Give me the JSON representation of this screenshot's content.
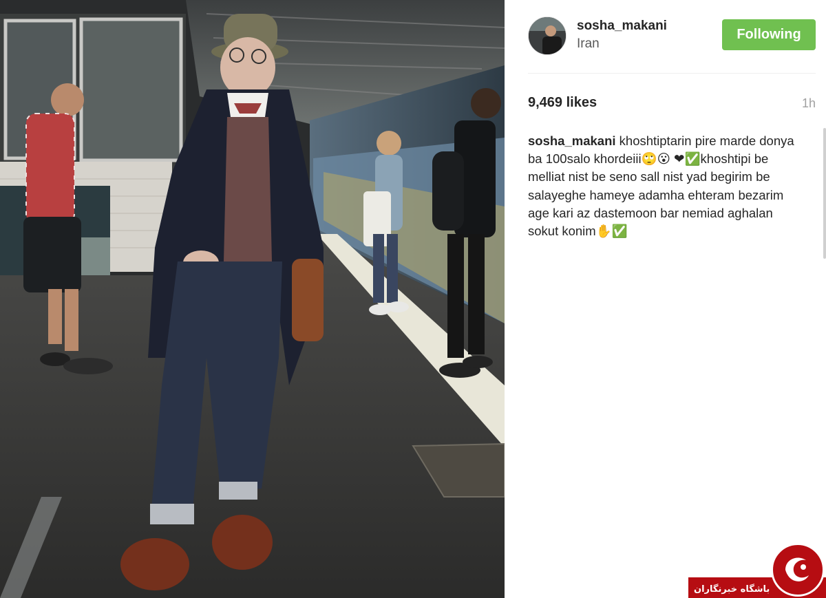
{
  "post": {
    "username": "sosha_makani",
    "location": "Iran",
    "follow_label": "Following",
    "likes": "9,469 likes",
    "time_ago": "1h",
    "caption_user": "sosha_makani",
    "caption_text": "khoshtiptarin pire marde donya ba 100salo khordeiii🙄😮 ❤✅khoshtipi be melliat nist be seno sall nist yad begirim be salayeghe hameye adamha ehteram bezarim age kari az dastemoon bar nemiad aghalan sokut konim✋✅"
  },
  "watermark": {
    "text": "باشگاه خبرنگاران"
  },
  "colors": {
    "follow_button": "#70c050",
    "watermark_red": "#b60d12"
  },
  "icons": {
    "avatar": "profile-photo",
    "seal": "logo-seal"
  }
}
